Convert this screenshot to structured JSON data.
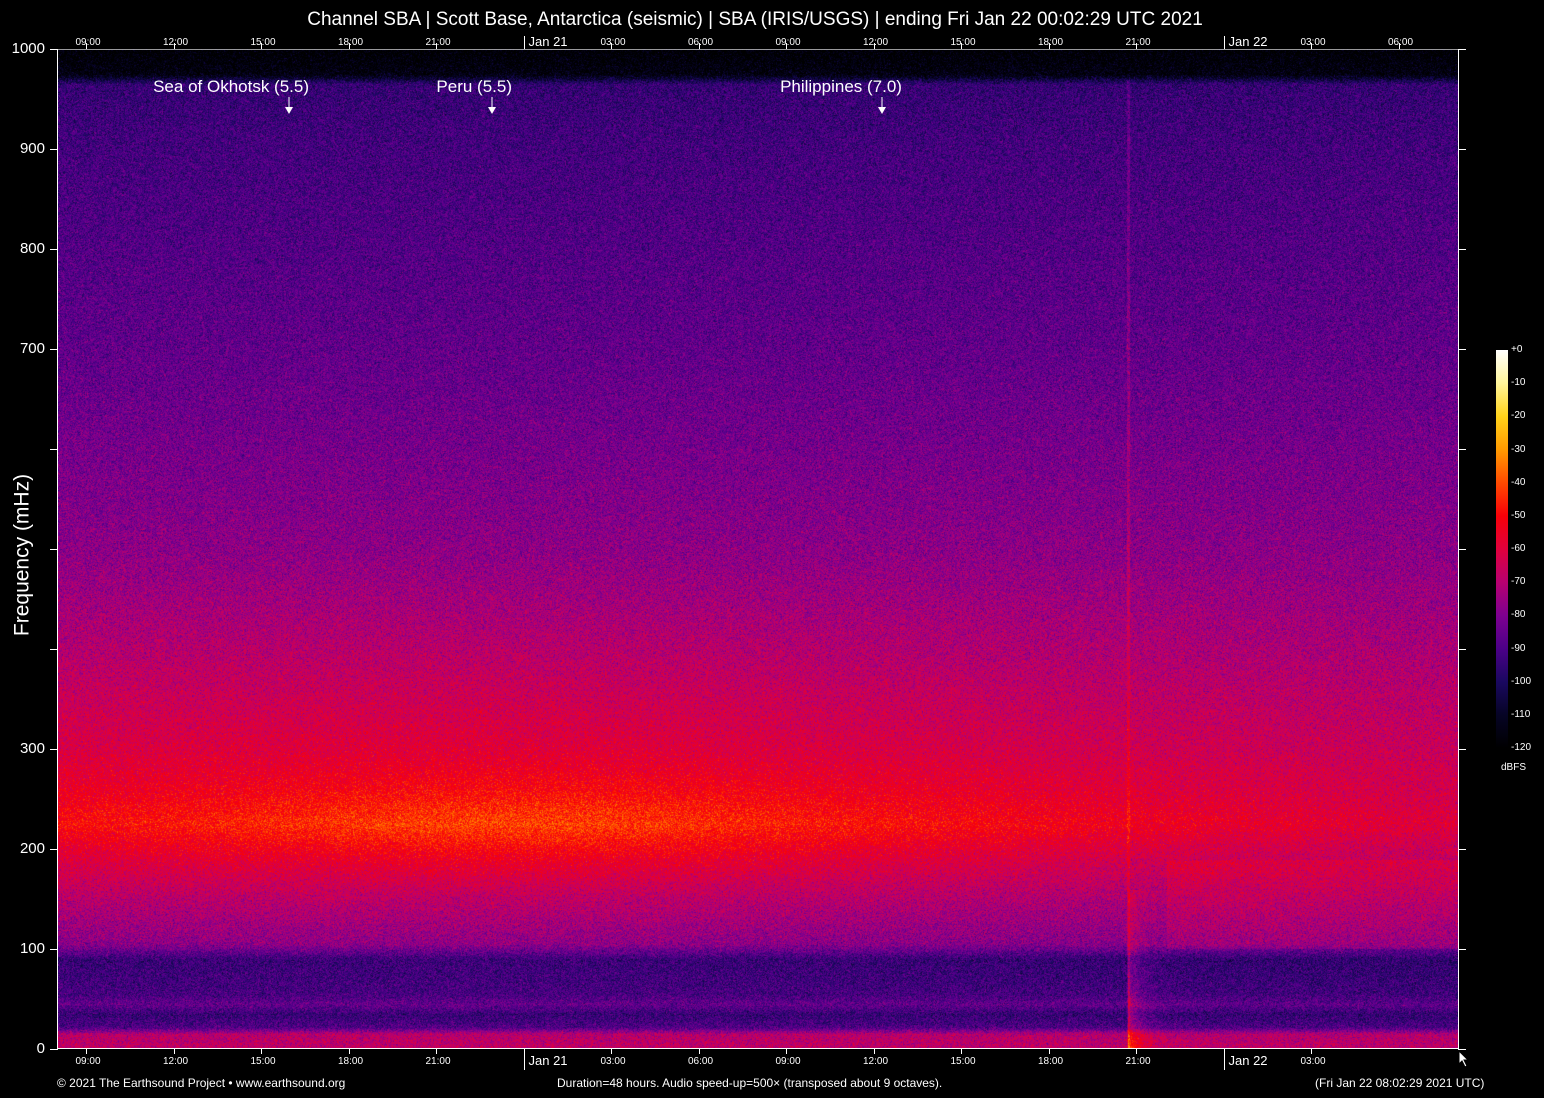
{
  "chart_data": {
    "type": "heatmap",
    "title": "Channel SBA | Scott Base, Antarctica (seismic) | SBA (IRIS/USGS) | ending Fri Jan 22 00:02:29 UTC 2021",
    "ylabel": "Frequency (mHz)",
    "xlabel": "",
    "ylim": [
      0,
      1000
    ],
    "xlim_hours": [
      0,
      48
    ],
    "y_ticks": [
      0,
      100,
      200,
      300,
      400,
      500,
      600,
      700,
      800,
      900,
      1000
    ],
    "y_tick_labels": [
      "0",
      "100",
      "200",
      "300",
      "",
      "",
      "",
      "700",
      "800",
      "900",
      "1000"
    ],
    "x_ticks_top": [
      {
        "label": "09:00",
        "hour": 0.96,
        "day": false
      },
      {
        "label": "12:00",
        "hour": 3.96,
        "day": false
      },
      {
        "label": "15:00",
        "hour": 6.96,
        "day": false
      },
      {
        "label": "18:00",
        "hour": 9.96,
        "day": false
      },
      {
        "label": "21:00",
        "hour": 12.96,
        "day": false
      },
      {
        "label": "Jan 21",
        "hour": 15.96,
        "day": true
      },
      {
        "label": "03:00",
        "hour": 18.96,
        "day": false
      },
      {
        "label": "06:00",
        "hour": 21.96,
        "day": false
      },
      {
        "label": "09:00",
        "hour": 24.96,
        "day": false
      },
      {
        "label": "12:00",
        "hour": 27.96,
        "day": false
      },
      {
        "label": "15:00",
        "hour": 30.96,
        "day": false
      },
      {
        "label": "18:00",
        "hour": 33.96,
        "day": false
      },
      {
        "label": "21:00",
        "hour": 36.96,
        "day": false
      },
      {
        "label": "Jan 22",
        "hour": 39.96,
        "day": true
      },
      {
        "label": "03:00",
        "hour": 42.96,
        "day": false
      },
      {
        "label": "06:00",
        "hour": 45.96,
        "day": false
      }
    ],
    "x_ticks_bottom": [
      {
        "label": "09:00",
        "hour": 0.96,
        "day": false
      },
      {
        "label": "12:00",
        "hour": 3.96,
        "day": false
      },
      {
        "label": "15:00",
        "hour": 6.96,
        "day": false
      },
      {
        "label": "18:00",
        "hour": 9.96,
        "day": false
      },
      {
        "label": "21:00",
        "hour": 12.96,
        "day": false
      },
      {
        "label": "Jan 21",
        "hour": 15.96,
        "day": true
      },
      {
        "label": "03:00",
        "hour": 18.96,
        "day": false
      },
      {
        "label": "06:00",
        "hour": 21.96,
        "day": false
      },
      {
        "label": "09:00",
        "hour": 24.96,
        "day": false
      },
      {
        "label": "12:00",
        "hour": 27.96,
        "day": false
      },
      {
        "label": "15:00",
        "hour": 30.96,
        "day": false
      },
      {
        "label": "18:00",
        "hour": 33.96,
        "day": false
      },
      {
        "label": "21:00",
        "hour": 36.96,
        "day": false
      },
      {
        "label": "Jan 22",
        "hour": 39.96,
        "day": true
      },
      {
        "label": "03:00",
        "hour": 42.96,
        "day": false
      }
    ],
    "annotations": [
      {
        "label": "Sea of Okhotsk (5.5)",
        "hour": 7.92
      },
      {
        "label": "Peru (5.5)",
        "hour": 14.88
      },
      {
        "label": "Philippines (7.0)",
        "hour": 28.25
      }
    ],
    "colorbar": {
      "unit": "dBFS",
      "range": [
        -120,
        0
      ],
      "tick_labels": [
        "+0",
        "-10",
        "-20",
        "-30",
        "-40",
        "-50",
        "-60",
        "-70",
        "-80",
        "-90",
        "-100",
        "-110",
        "-120"
      ],
      "stops": [
        {
          "db": 0,
          "color": "#ffffff"
        },
        {
          "db": -10,
          "color": "#fff59a"
        },
        {
          "db": -20,
          "color": "#ffd21a"
        },
        {
          "db": -30,
          "color": "#ff9a00"
        },
        {
          "db": -40,
          "color": "#ff4a00"
        },
        {
          "db": -50,
          "color": "#f80008"
        },
        {
          "db": -60,
          "color": "#e0003c"
        },
        {
          "db": -70,
          "color": "#b80070"
        },
        {
          "db": -80,
          "color": "#7e0090"
        },
        {
          "db": -90,
          "color": "#4c0088"
        },
        {
          "db": -100,
          "color": "#1a0860"
        },
        {
          "db": -110,
          "color": "#060425"
        },
        {
          "db": -120,
          "color": "#000000"
        }
      ]
    },
    "series_profile_db": [
      [
        0,
        -68
      ],
      [
        15,
        -70
      ],
      [
        22,
        -90
      ],
      [
        35,
        -95
      ],
      [
        45,
        -86
      ],
      [
        55,
        -92
      ],
      [
        90,
        -95
      ],
      [
        105,
        -79
      ],
      [
        150,
        -71
      ],
      [
        190,
        -62
      ],
      [
        225,
        -52
      ],
      [
        260,
        -58
      ],
      [
        300,
        -63
      ],
      [
        400,
        -71
      ],
      [
        500,
        -78
      ],
      [
        700,
        -86
      ],
      [
        900,
        -92
      ],
      [
        965,
        -95
      ],
      [
        975,
        -116
      ],
      [
        1000,
        -120
      ]
    ],
    "events": [
      {
        "hour": 36.68,
        "note": "broadband transient, strongest below 150 mHz"
      }
    ]
  },
  "footer": {
    "copyright": "© 2021 The Earthsound Project • www.earthsound.org",
    "duration": "Duration=48 hours. Audio speed-up=500× (transposed about 9 octaves).",
    "timestamp": "(Fri Jan 22 08:02:29 2021 UTC)"
  }
}
